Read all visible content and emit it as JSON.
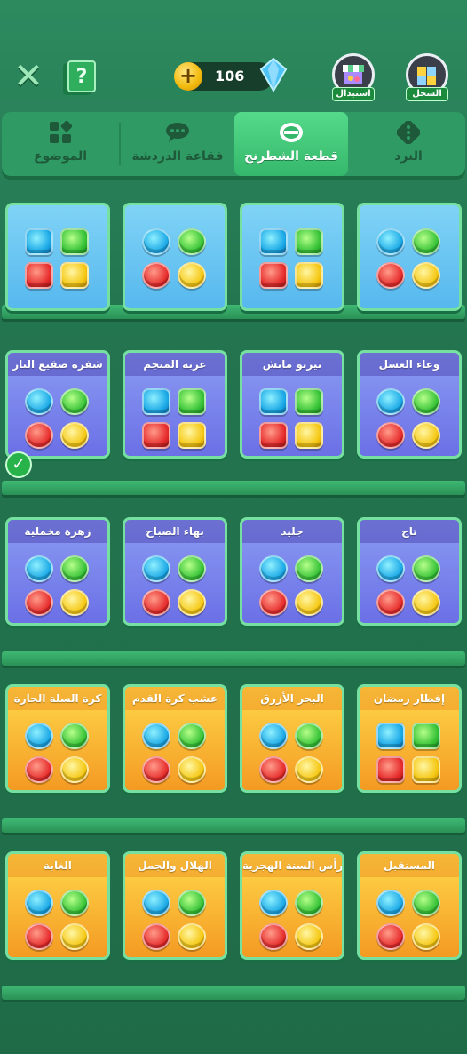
{
  "topbar": {
    "close_icon": "✕",
    "help_icon": "?",
    "coins_icon": "+",
    "currency_amount": "106",
    "exchange_label": "استبدال",
    "history_label": "السجل"
  },
  "tabs": [
    {
      "label": "النرد",
      "icon": "dice-icon"
    },
    {
      "label": "قطعة الشطرنج",
      "icon": "chess-piece-icon",
      "active": true
    },
    {
      "label": "فقاعة الدردشة",
      "icon": "chat-bubble-icon"
    },
    {
      "label": "الموضوع",
      "icon": "theme-grid-icon"
    }
  ],
  "rows": [
    [
      {
        "title": "",
        "style": "blue",
        "pieces": "round"
      },
      {
        "title": "",
        "style": "blue",
        "pieces": "chest"
      },
      {
        "title": "",
        "style": "blue",
        "pieces": "candy"
      },
      {
        "title": "",
        "style": "blue",
        "pieces": "cup"
      }
    ],
    [
      {
        "title": "وعاء العسل",
        "style": "purple",
        "pieces": "pot"
      },
      {
        "title": "تيربو ماتش",
        "style": "purple",
        "pieces": "shape"
      },
      {
        "title": "عربة المنجم",
        "style": "purple",
        "pieces": "cart"
      },
      {
        "title": "شفرة صقيع النار",
        "style": "purple",
        "pieces": "blade",
        "selected": true
      }
    ],
    [
      {
        "title": "تاج",
        "style": "purple",
        "pieces": "round"
      },
      {
        "title": "جليد",
        "style": "purple",
        "pieces": "round"
      },
      {
        "title": "بهاء الصباح",
        "style": "purple",
        "pieces": "round"
      },
      {
        "title": "زهرة مخملية",
        "style": "purple",
        "pieces": "round"
      }
    ],
    [
      {
        "title": "إفطار رمضان",
        "style": "orange",
        "pieces": "cup"
      },
      {
        "title": "البحر الأزرق",
        "style": "orange",
        "pieces": "round"
      },
      {
        "title": "عشب كرة القدم",
        "style": "orange",
        "pieces": "round"
      },
      {
        "title": "كرة السلة الحارة",
        "style": "orange",
        "pieces": "round"
      }
    ],
    [
      {
        "title": "المستقبل",
        "style": "orange",
        "pieces": "round"
      },
      {
        "title": "رأس السنة الهجرية",
        "style": "orange",
        "pieces": "round"
      },
      {
        "title": "الهلال والجمل",
        "style": "orange",
        "pieces": "round"
      },
      {
        "title": "الغابة",
        "style": "orange",
        "pieces": "round"
      }
    ]
  ],
  "check_icon": "✓"
}
